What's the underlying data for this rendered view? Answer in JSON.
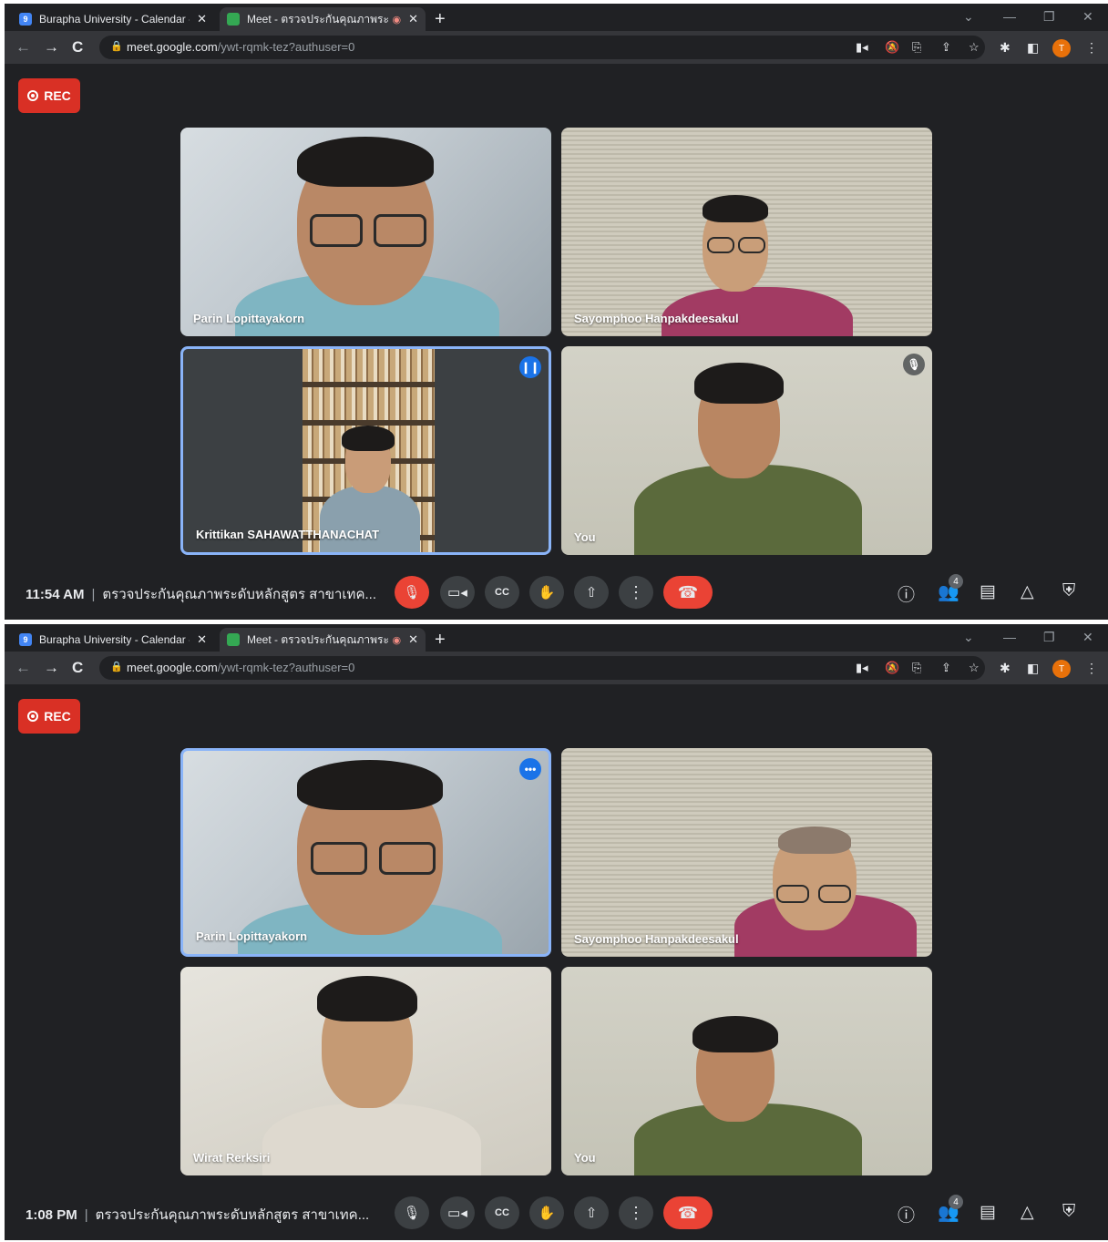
{
  "screens": [
    {
      "tabs": {
        "calendar_title": "Burapha University - Calendar - ",
        "meet_title": "Meet - ตรวจประกันคุณภาพระดั",
        "new_tab": "+"
      },
      "address": {
        "host": "meet.google.com",
        "path": "/ywt-rqmk-tez?authuser=0"
      },
      "profile_initial": "T",
      "rec_label": "REC",
      "participants": [
        {
          "name": "Parin Lopittayakorn"
        },
        {
          "name": "Sayomphoo Hanpakdeesakul"
        },
        {
          "name": "Krittikan SAHAWATTHANACHAT",
          "speaking": true
        },
        {
          "name": "You",
          "muted": true
        }
      ],
      "footer": {
        "time": "11:54 AM",
        "meeting_title": "ตรวจประกันคุณภาพระดับหลักสูตร สาขาเทค...",
        "participant_count": "4",
        "mic_muted": true
      }
    },
    {
      "tabs": {
        "calendar_title": "Burapha University - Calendar - ",
        "meet_title": "Meet - ตรวจประกันคุณภาพระดั",
        "new_tab": "+"
      },
      "address": {
        "host": "meet.google.com",
        "path": "/ywt-rqmk-tez?authuser=0"
      },
      "profile_initial": "T",
      "rec_label": "REC",
      "participants": [
        {
          "name": "Parin Lopittayakorn",
          "speaking": true
        },
        {
          "name": "Sayomphoo Hanpakdeesakul"
        },
        {
          "name": "Wirat Rerksiri"
        },
        {
          "name": "You"
        }
      ],
      "footer": {
        "time": "1:08 PM",
        "meeting_title": "ตรวจประกันคุณภาพระดับหลักสูตร สาขาเทค...",
        "participant_count": "4",
        "mic_muted": false
      }
    }
  ],
  "icons": {
    "back": "←",
    "forward": "→",
    "reload": "C",
    "close": "✕",
    "minimize": "—",
    "restore": "❐",
    "chevron": "⌄",
    "lock": "🔒",
    "star": "☆",
    "menu": "⋮",
    "extension": "✱"
  },
  "colors": {
    "accent": "#8ab4f8",
    "danger": "#ea4335",
    "record": "#d93025",
    "background": "#202124"
  }
}
